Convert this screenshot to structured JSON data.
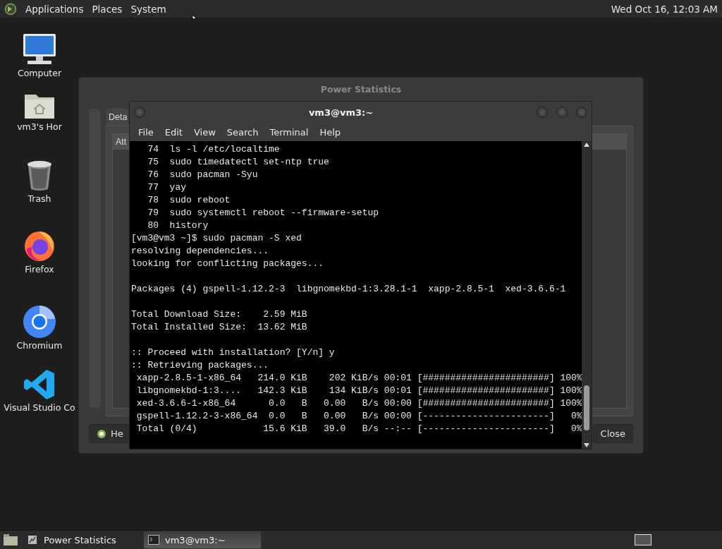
{
  "top_panel": {
    "menus": [
      "Applications",
      "Places",
      "System"
    ],
    "clock": "Wed Oct 16, 12:03 AM"
  },
  "desktop_icons": [
    {
      "label": "Computer",
      "kind": "computer"
    },
    {
      "label": "vm3's Hor",
      "kind": "home"
    },
    {
      "label": "Trash",
      "kind": "trash"
    },
    {
      "label": "Firefox",
      "kind": "firefox"
    },
    {
      "label": "Chromium",
      "kind": "chromium"
    },
    {
      "label": "Visual Studio Co",
      "kind": "vscode"
    }
  ],
  "power_window": {
    "title": "Power Statistics",
    "tab": "Deta",
    "column": "Att",
    "help_button": "He",
    "close_button": "Close"
  },
  "terminal": {
    "title": "vm3@vm3:~",
    "menu": [
      "File",
      "Edit",
      "View",
      "Search",
      "Terminal",
      "Help"
    ],
    "blocks": [
      [
        "   74  ls -l /etc/localtime",
        "   75  sudo timedatectl set-ntp true",
        "   76  sudo pacman -Syu",
        "   77  yay",
        "   78  sudo reboot",
        "   79  sudo systemctl reboot --firmware-setup",
        "   80  history",
        "[vm3@vm3 ~]$ sudo pacman -S xed",
        "resolving dependencies...",
        "looking for conflicting packages..."
      ],
      [
        "Packages (4) gspell-1.12.2-3  libgnomekbd-1:3.28.1-1  xapp-2.8.5-1  xed-3.6.6-1"
      ],
      [
        "Total Download Size:    2.59 MiB",
        "Total Installed Size:  13.62 MiB"
      ],
      [
        ":: Proceed with installation? [Y/n] y",
        ":: Retrieving packages...",
        " xapp-2.8.5-1-x86_64   214.0 KiB    202 KiB/s 00:01 [#######################] 100%",
        " libgnomekbd-1:3....   142.3 KiB    134 KiB/s 00:01 [#######################] 100%",
        " xed-3.6.6-1-x86_64      0.0   B   0.00   B/s 00:00 [#######################] 100%",
        " gspell-1.12.2-3-x86_64  0.0   B   0.00   B/s 00:00 [-----------------------]   0%",
        " Total (0/4)            15.6 KiB   39.0   B/s --:-- [-----------------------]   0%"
      ]
    ]
  },
  "taskbar": {
    "items": [
      {
        "label": "Power Statistics",
        "kind": "power",
        "selected": false
      },
      {
        "label": "vm3@vm3:~",
        "kind": "terminal",
        "selected": true
      }
    ]
  }
}
